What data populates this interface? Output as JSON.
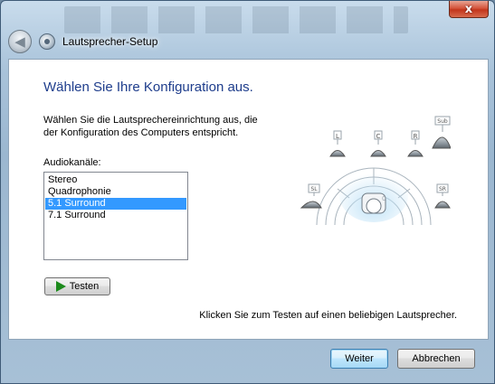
{
  "window": {
    "title": "Lautsprecher-Setup",
    "close_glyph": "x"
  },
  "page": {
    "heading": "Wählen Sie Ihre Konfiguration aus.",
    "description_line1": "Wählen Sie die Lautsprechereinrichtung aus, die",
    "description_line2": "der Konfiguration des Computers entspricht.",
    "list_label": "Audiokanäle:",
    "channels": [
      "Stereo",
      "Quadrophonie",
      "5.1 Surround",
      "7.1 Surround"
    ],
    "selected_channel": "5.1 Surround",
    "test_button": "Testen",
    "hint": "Klicken Sie zum Testen auf einen beliebigen Lautsprecher."
  },
  "diagram": {
    "speaker_labels": {
      "left": "L",
      "center": "C",
      "right": "R",
      "sub": "Sub",
      "side_left": "SL",
      "side_right": "SR"
    }
  },
  "footer": {
    "next_button": "Weiter",
    "cancel_button": "Abbrechen"
  },
  "colors": {
    "heading": "#1e3d8c",
    "selection": "#3399ff",
    "play_icon": "#1c8a1c"
  }
}
